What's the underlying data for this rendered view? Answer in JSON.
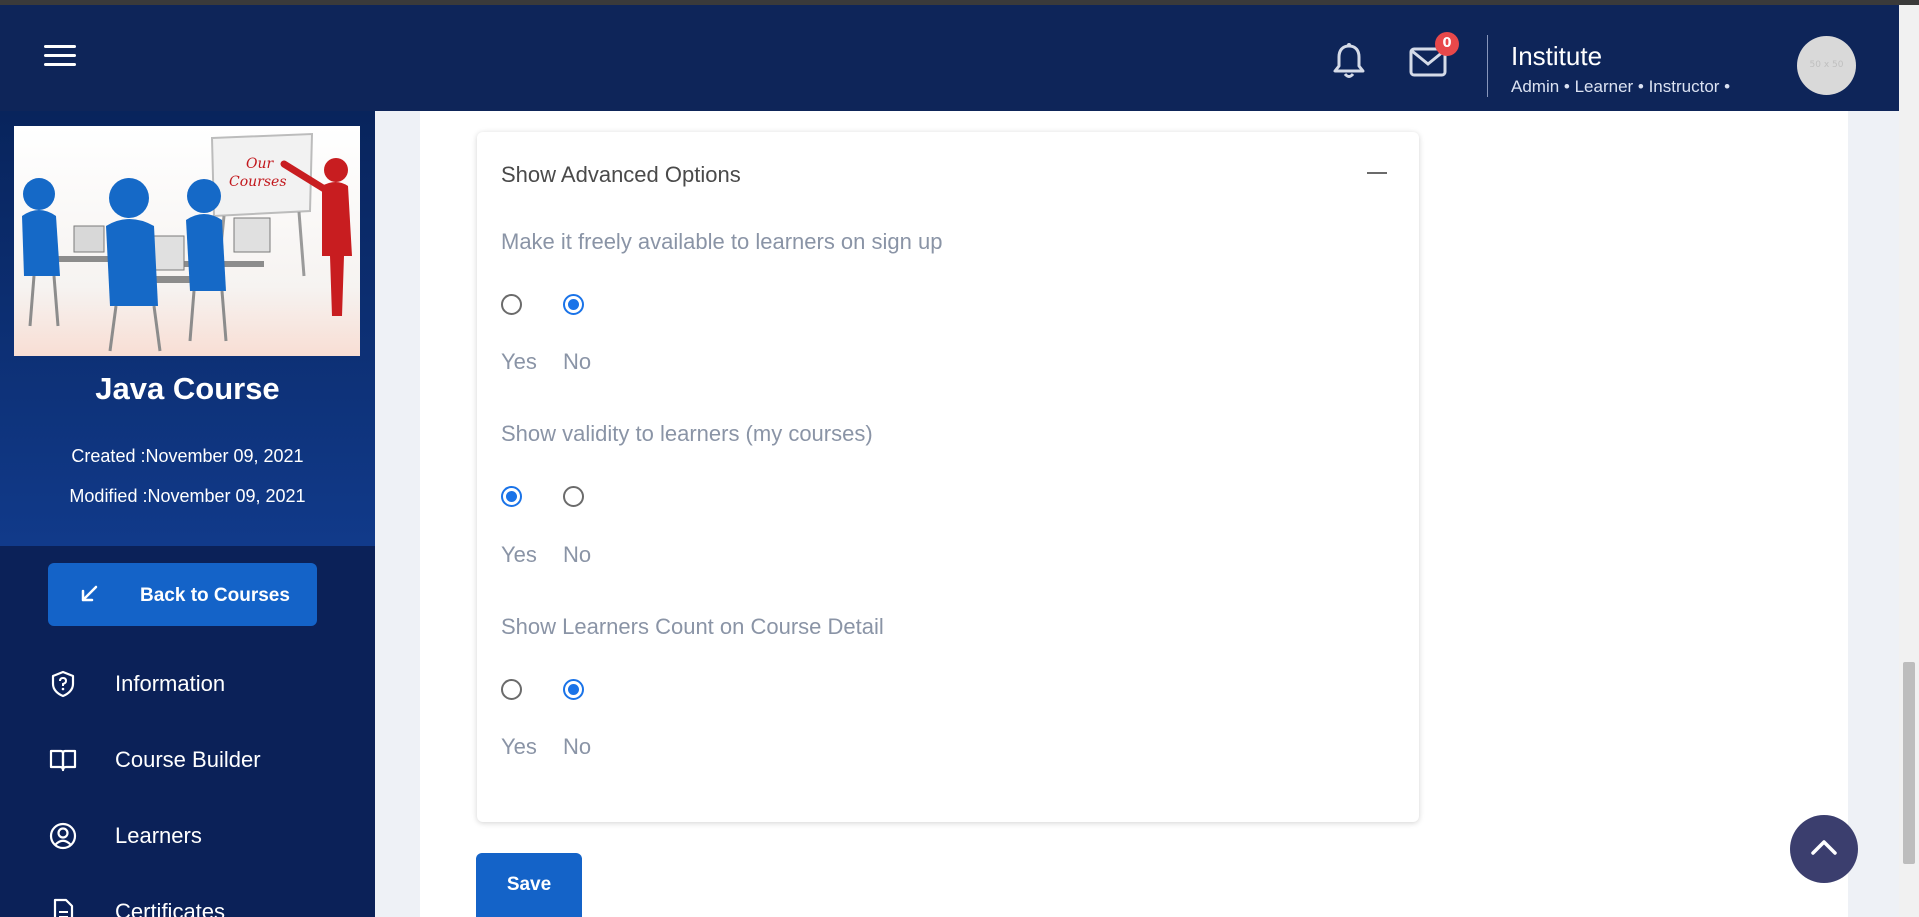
{
  "header": {
    "menu_icon": "hamburger-menu-icon",
    "notifications_icon": "bell-icon",
    "messages_icon": "mail-icon",
    "messages_badge": "0",
    "institute_name": "Institute",
    "roles": "Admin • Learner • Instructor •",
    "avatar_placeholder": "50 x 50",
    "colors": {
      "background": "#0e2559",
      "badge": "#e8484a"
    }
  },
  "sidebar": {
    "course_image_text": "Our Courses",
    "course_title": "Java Course",
    "created_label": "Created :",
    "created_value": "November 09, 2021",
    "modified_label": "Modified :",
    "modified_value": "November 09, 2021",
    "back_button": "Back to Courses",
    "items": [
      {
        "label": "Information",
        "icon": "shield-question-icon"
      },
      {
        "label": "Course Builder",
        "icon": "open-book-icon"
      },
      {
        "label": "Learners",
        "icon": "user-circle-icon"
      },
      {
        "label": "Certificates",
        "icon": "document-icon"
      }
    ]
  },
  "advanced": {
    "title": "Show Advanced Options",
    "options": [
      {
        "question": "Make it freely available to learners on sign up",
        "yes": "Yes",
        "no": "No",
        "selected": "No"
      },
      {
        "question": "Show validity to learners (my courses)",
        "yes": "Yes",
        "no": "No",
        "selected": "Yes"
      },
      {
        "question": "Show Learners Count on Course Detail",
        "yes": "Yes",
        "no": "No",
        "selected": "No"
      }
    ]
  },
  "save_button": "Save",
  "scroll_top_icon": "chevron-up-icon",
  "accent_color": "#1463c8"
}
